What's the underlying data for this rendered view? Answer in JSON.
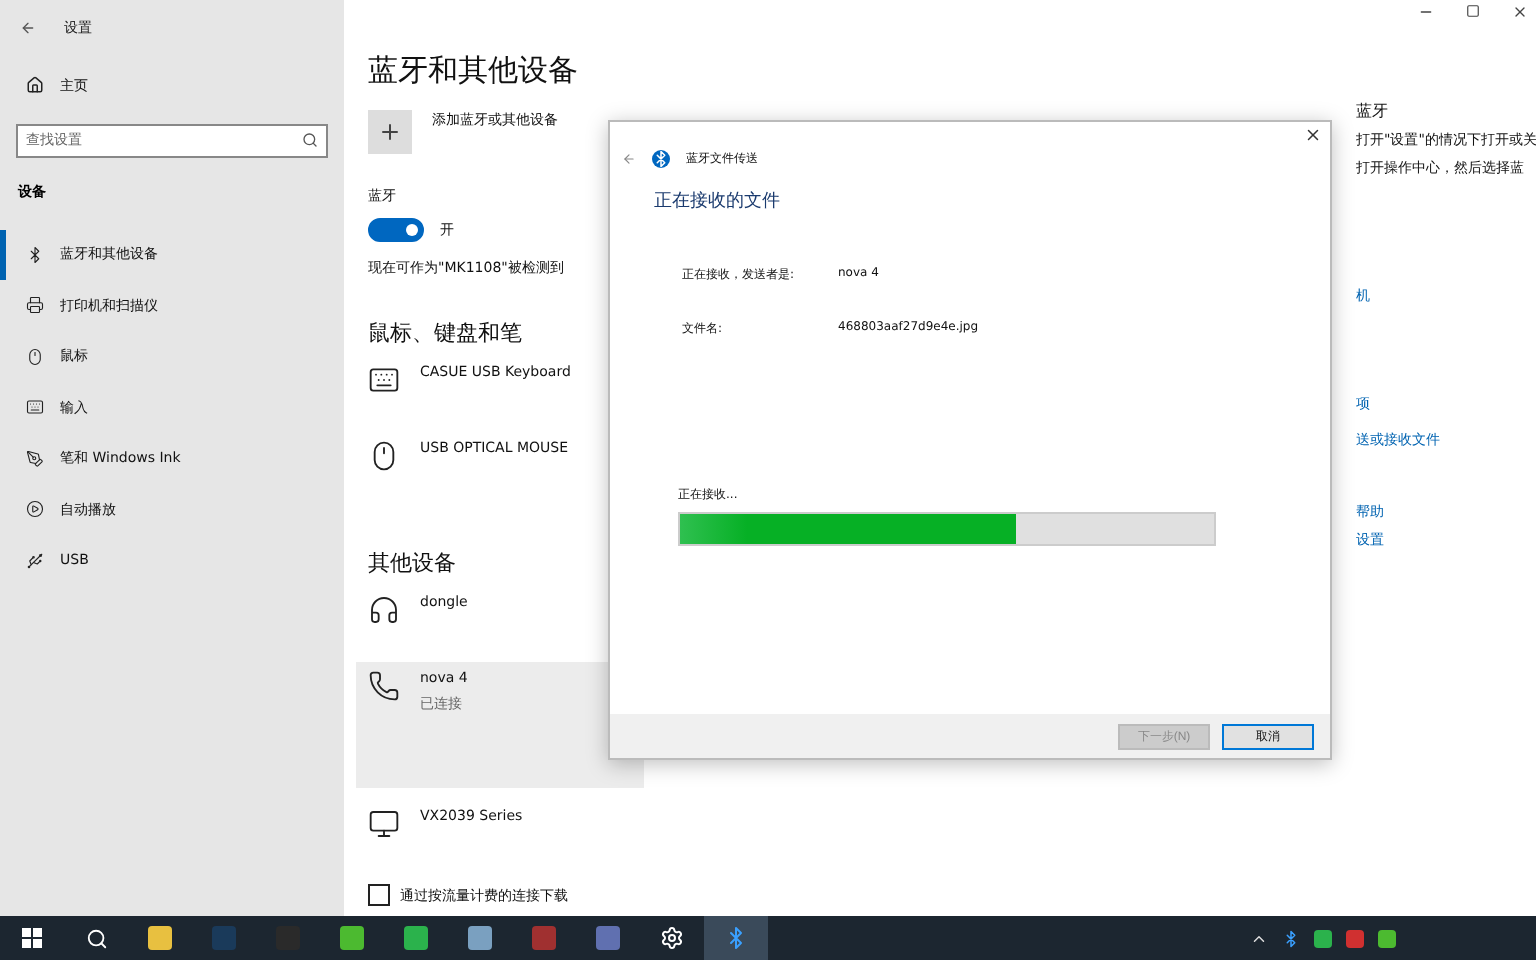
{
  "window": {
    "title": "设置"
  },
  "sidebar": {
    "home": "主页",
    "search": {
      "placeholder": "查找设置"
    },
    "section": "设备",
    "items": [
      {
        "label": "蓝牙和其他设备",
        "kind": "bluetooth",
        "selected": true
      },
      {
        "label": "打印机和扫描仪",
        "kind": "printer",
        "selected": false
      },
      {
        "label": "鼠标",
        "kind": "mouse",
        "selected": false
      },
      {
        "label": "输入",
        "kind": "keyboard",
        "selected": false
      },
      {
        "label": "笔和 Windows Ink",
        "kind": "pen",
        "selected": false
      },
      {
        "label": "自动播放",
        "kind": "autoplay",
        "selected": false
      },
      {
        "label": "USB",
        "kind": "usb",
        "selected": false
      }
    ]
  },
  "main": {
    "title": "蓝牙和其他设备",
    "add_device": "添加蓝牙或其他设备",
    "bluetooth_label": "蓝牙",
    "bluetooth_toggle": {
      "on": true,
      "label": "开"
    },
    "discoverable": "现在可作为\"MK1108\"被检测到",
    "groups": [
      {
        "heading": "鼠标、键盘和笔",
        "devices": [
          {
            "name": "CASUE USB Keyboard",
            "kind": "keyboard",
            "selected": false
          },
          {
            "name": "USB OPTICAL MOUSE",
            "kind": "mouse",
            "selected": false
          }
        ]
      },
      {
        "heading": "其他设备",
        "devices": [
          {
            "name": "dongle",
            "kind": "headset",
            "selected": false
          },
          {
            "name": "nova 4",
            "status": "已连接",
            "kind": "phone",
            "selected": true
          },
          {
            "name": "VX2039 Series",
            "kind": "monitor",
            "selected": false
          }
        ]
      }
    ],
    "metered": {
      "label": "通过按流量计费的连接下载",
      "checked": false
    }
  },
  "side_column": {
    "heading": "蓝牙",
    "lines": [
      "打开\"设置\"的情况下打开或关",
      "打开操作中心，然后选择蓝"
    ],
    "links": [
      "机",
      "项",
      "送或接收文件",
      "帮助",
      "设置"
    ]
  },
  "dialog": {
    "title": "蓝牙文件传送",
    "heading": "正在接收的文件",
    "fields": [
      {
        "label": "正在接收，发送者是:",
        "value": "nova 4"
      },
      {
        "label": "文件名:",
        "value": "468803aaf27d9e4e.jpg"
      }
    ],
    "progress": {
      "label": "正在接收...",
      "level": 0.63
    },
    "buttons": [
      {
        "label": "下一步(N)",
        "disabled": true
      },
      {
        "label": "取消",
        "disabled": false
      }
    ]
  },
  "taskbar": {
    "apps": [
      {
        "kind": "file-explorer",
        "active": false
      },
      {
        "kind": "ps",
        "active": false
      },
      {
        "kind": "recorder",
        "active": false
      },
      {
        "kind": "green-app",
        "active": false
      },
      {
        "kind": "chat",
        "active": false
      },
      {
        "kind": "notepad",
        "active": false
      },
      {
        "kind": "game",
        "active": false
      },
      {
        "kind": "printer",
        "active": false
      },
      {
        "kind": "settings",
        "active": false
      },
      {
        "kind": "bluetooth",
        "active": true
      }
    ]
  }
}
